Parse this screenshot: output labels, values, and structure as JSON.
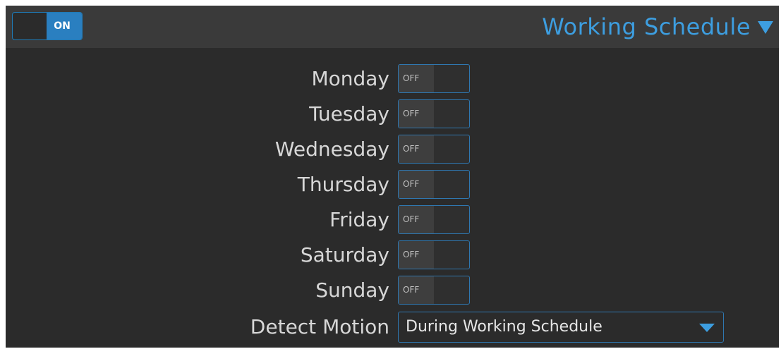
{
  "header": {
    "master_toggle": {
      "state_label": "ON",
      "checked": true
    },
    "section_title": "Working Schedule",
    "section_icon": "triangle-down-icon"
  },
  "schedule": {
    "days": [
      {
        "label": "Monday",
        "state_label": "OFF",
        "checked": false
      },
      {
        "label": "Tuesday",
        "state_label": "OFF",
        "checked": false
      },
      {
        "label": "Wednesday",
        "state_label": "OFF",
        "checked": false
      },
      {
        "label": "Thursday",
        "state_label": "OFF",
        "checked": false
      },
      {
        "label": "Friday",
        "state_label": "OFF",
        "checked": false
      },
      {
        "label": "Saturday",
        "state_label": "OFF",
        "checked": false
      },
      {
        "label": "Sunday",
        "state_label": "OFF",
        "checked": false
      }
    ],
    "detect_motion": {
      "label": "Detect Motion",
      "selected": "During Working Schedule",
      "icon": "chevron-down-icon"
    }
  },
  "colors": {
    "accent": "#3d9ee0",
    "toggle_on": "#2a7fc0",
    "panel_bg": "#2b2b2b",
    "header_bg": "#3a3a3a",
    "text": "#d7d7d7"
  }
}
